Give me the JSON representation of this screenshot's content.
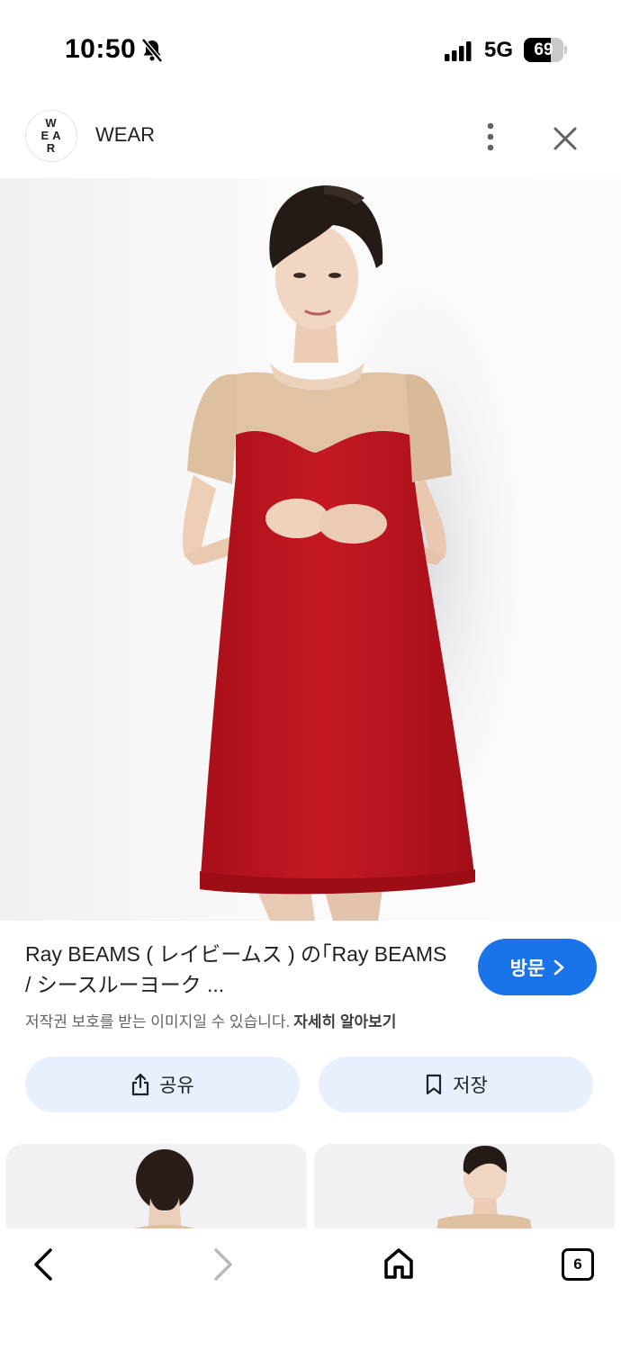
{
  "status_bar": {
    "time": "10:50",
    "network": "5G",
    "battery_level": "69",
    "battery_fraction": 0.69,
    "icons": [
      "bell-slash-icon",
      "signal-bars-icon",
      "battery-icon"
    ]
  },
  "header": {
    "logo_text": "WEAR",
    "site_name": "WEAR",
    "icons": [
      "more-vertical-icon",
      "close-icon"
    ]
  },
  "image": {
    "subject": "woman-in-red-dress-photo"
  },
  "caption": {
    "title": "Ray BEAMS ( レイビームス ) の｢Ray BEAMS / シースルーヨーク ...",
    "visit_label": "방문",
    "copyright_text": "저작권 보호를 받는 이미지일 수 있습니다.",
    "learn_more": "자세히 알아보기"
  },
  "actions": {
    "share_label": "공유",
    "save_label": "저장"
  },
  "bottom_nav": {
    "tab_count": "6",
    "icons": [
      "back-icon",
      "forward-icon",
      "home-icon",
      "tabs-icon"
    ]
  },
  "colors": {
    "accent": "#1a73e8",
    "action_bg": "#e8f0fe",
    "dress_red": "#b5141e"
  }
}
